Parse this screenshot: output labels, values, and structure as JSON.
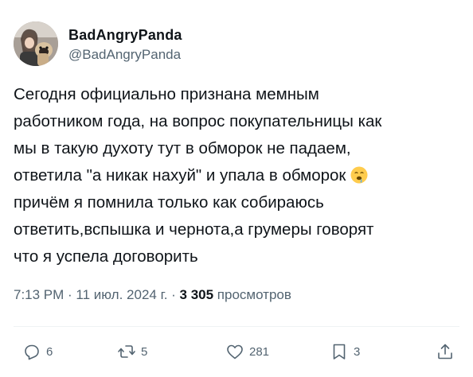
{
  "author": {
    "display_name": "BadAngryPanda",
    "handle": "@BadAngryPanda",
    "avatar_icon": "avatar-photo"
  },
  "tweet": {
    "lines": [
      "Сегодня официально признана мемным",
      "работником года, на вопрос покупательницы как",
      "мы в такую духоту тут в обморок не падаем,",
      "ответила \"а никак нахуй\" и упала в обморок",
      "причём я помнила только как собираюсь",
      "ответить,вспышка и чернота,а грумеры говорят",
      "что я успела договорить"
    ],
    "emoji_icon": "face-with-spiral-eyes-drool-emoji"
  },
  "meta": {
    "time": "7:13 PM",
    "separator1": " · ",
    "date": "11 июл. 2024 г.",
    "separator2": " · ",
    "views_count": "3 305",
    "views_label": " просмотров"
  },
  "actions": {
    "replies": "6",
    "retweets": "5",
    "likes": "281",
    "bookmarks": "3"
  },
  "colors": {
    "text": "#0f1419",
    "secondary": "#536471",
    "divider": "#eff3f4"
  }
}
